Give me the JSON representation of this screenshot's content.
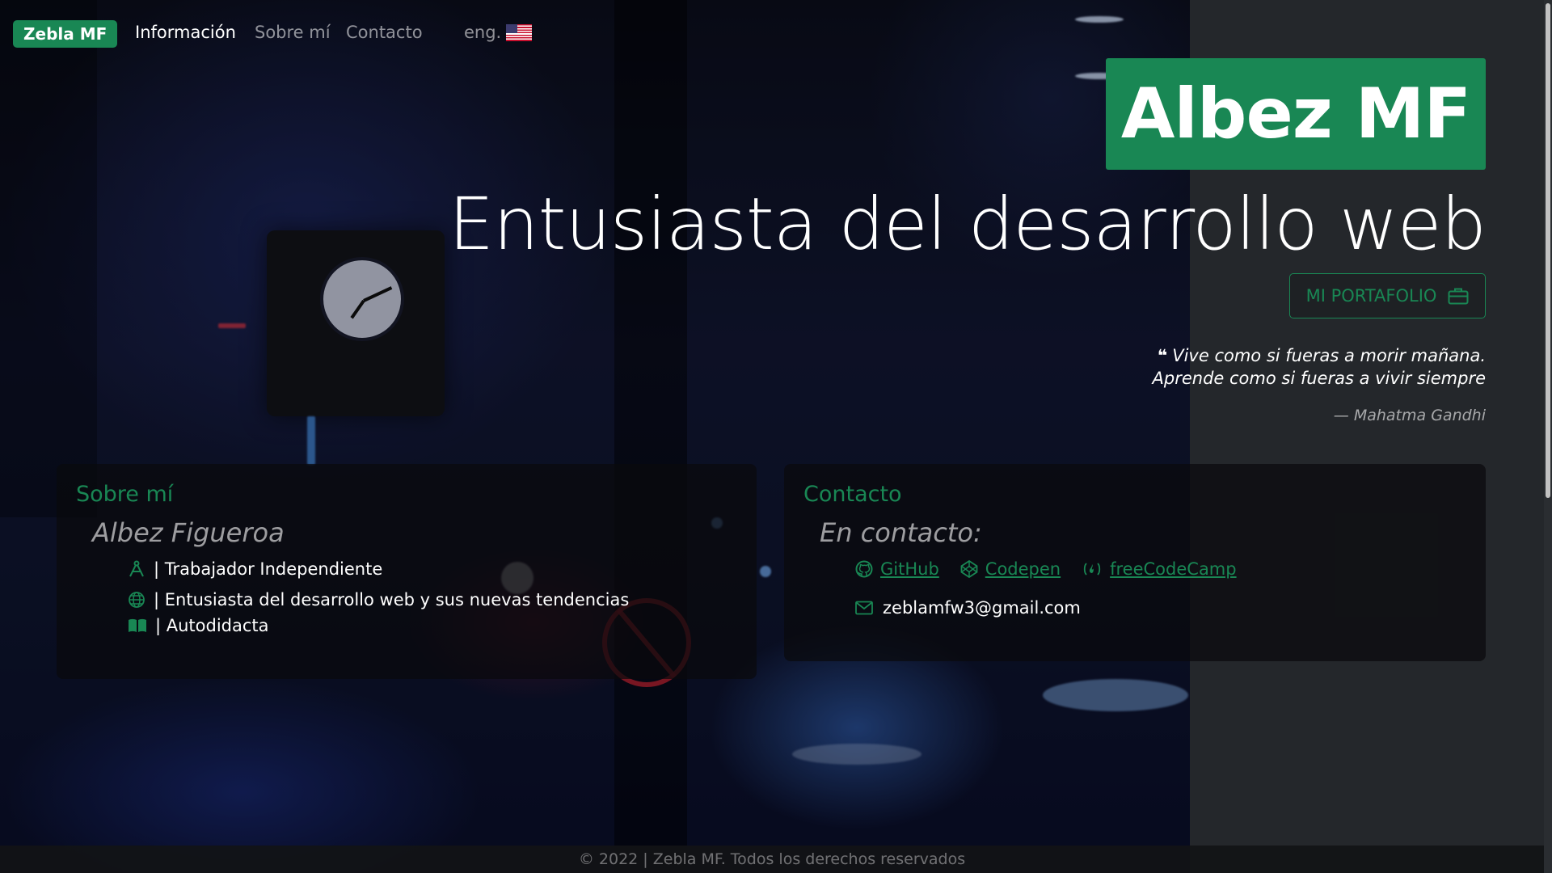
{
  "navbar": {
    "brand": "Zebla MF",
    "links": [
      "Información",
      "Sobre mí",
      "Contacto"
    ],
    "active_index": 0,
    "language": "eng.",
    "flag_icon": "us-flag-icon"
  },
  "hero": {
    "title": "Albez MF",
    "subtitle": "Entusiasta del desarrollo web",
    "portfolio_button": "MI PORTAFOLIO",
    "quote_line1": "Vive como si fueras a morir mañana.",
    "quote_line2": "Aprende como si fueras a vivir siempre",
    "quote_author": "— Mahatma Gandhi"
  },
  "about": {
    "title": "Sobre mí",
    "name": "Albez Figueroa",
    "items": [
      {
        "icon": "compass-icon",
        "text": "| Trabajador Independiente"
      },
      {
        "icon": "globe-icon",
        "text": "| Entusiasta del desarrollo web y sus nuevas tendencias"
      },
      {
        "icon": "book-icon",
        "text": "| Autodidacta"
      }
    ]
  },
  "contact": {
    "title": "Contacto",
    "subtitle": "En contacto:",
    "links": [
      {
        "icon": "github-icon",
        "label": "GitHub"
      },
      {
        "icon": "codepen-icon",
        "label": "Codepen"
      },
      {
        "icon": "freecodecamp-icon",
        "label": "freeCodeCamp"
      }
    ],
    "email_icon": "envelope-icon",
    "email": "zeblamfw3@gmail.com"
  },
  "footer": {
    "text": "© 2022 | Zebla MF. Todos los derechos reservados"
  },
  "colors": {
    "accent": "#198754",
    "page_background": "#24272b"
  }
}
